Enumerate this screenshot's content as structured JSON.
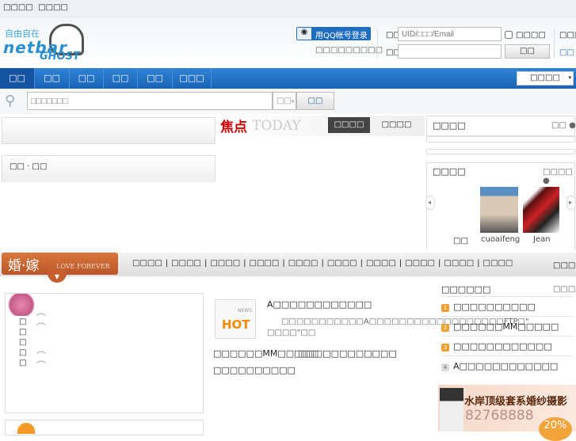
{
  "topbar": {
    "links": [
      "□□□□",
      "□□□□"
    ]
  },
  "logo": {
    "line1": "自由自在",
    "line2": "netbar",
    "line3": "GHOST"
  },
  "qq": {
    "button": "用QQ帐号登录",
    "icon": "penguin-icon",
    "subtext": "□□□□□□□□□"
  },
  "login": {
    "user_label": "□□",
    "user_placeholder": "UID/□□□/Email",
    "remember": "□□□□",
    "pass_label": "□□",
    "submit": "□□",
    "right1": "□□□□",
    "right2": "□□"
  },
  "nav": {
    "items": [
      "□□",
      "□□",
      "□□",
      "□□",
      "□□",
      "□□□"
    ],
    "select": "□□□□"
  },
  "search": {
    "placeholder": "□□□□□□□",
    "type": "□□",
    "button": "□□"
  },
  "focus": {
    "title": "焦点",
    "sub": "TODAY",
    "tabs": [
      "□□□□",
      "□□□□"
    ]
  },
  "left_box": {
    "label": "□□ · □□"
  },
  "right_panel1": {
    "title": "□□□□",
    "more": "□□"
  },
  "right_panel2": {
    "title": "□□□□",
    "more": "□□□□",
    "users": [
      "□□",
      "cuoaifeng",
      "Jean"
    ]
  },
  "wedding": {
    "title": "婚·嫁",
    "sub": "LOVE FOREVER",
    "links": [
      "□□□□",
      "□□□□",
      "□□□□",
      "□□□□",
      "□□□□",
      "□□□□",
      "□□□□",
      "□□□□",
      "□□□□",
      "□□□□"
    ],
    "right": "□□□□"
  },
  "vertical_text": [
    "□",
    "□",
    "□",
    "□",
    "□"
  ],
  "hot": {
    "badge": "HOT",
    "news": "NEWS",
    "headline": "A□□□□□□□□□□□□",
    "summary": "□□□□□□□□□□□A□□□□□□□□□□□□□□□□□□FTP□\" □□□□\"□□",
    "links": [
      "□□□□□□MM□□□□□",
      "□□□□□□□□□□□□",
      "□□□□□□□□□□"
    ]
  },
  "ranking": {
    "title": "□□□□□□",
    "more": "□□□□",
    "items": [
      "□□□□□□□□□□",
      "□□□□□□MM□□□□□",
      "□□□□□□□□□□□□",
      "A□□□□□□□□□□□□"
    ]
  },
  "ad": {
    "title": "水岸顶级套系婚纱摄影",
    "phone": "82768888",
    "badge": "20%"
  }
}
